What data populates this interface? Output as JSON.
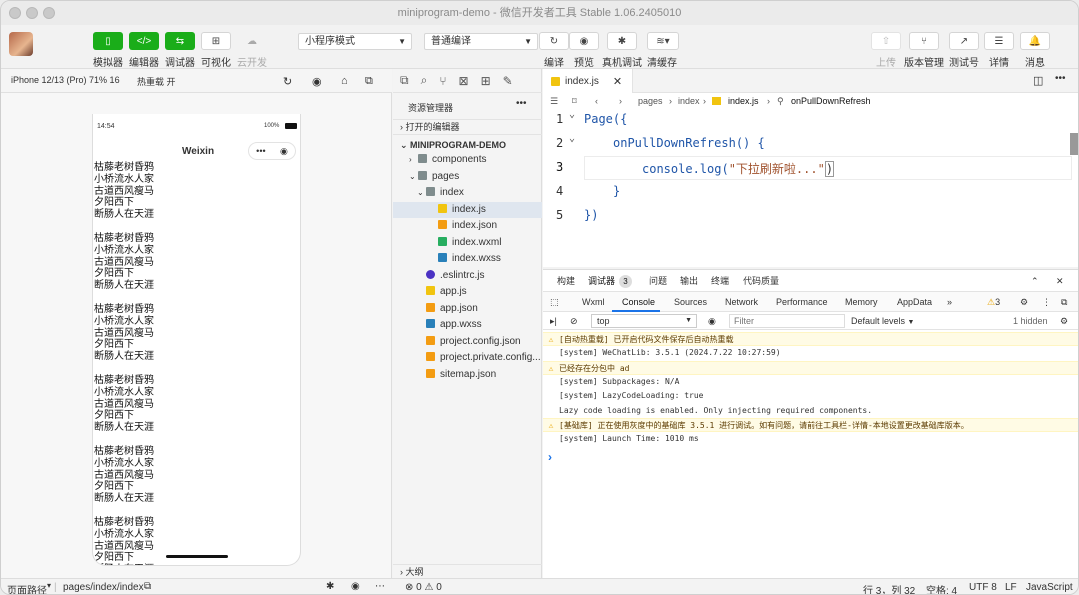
{
  "window": {
    "title": "miniprogram-demo - 微信开发者工具 Stable 1.06.2405010"
  },
  "toolbar": {
    "buttons": [
      {
        "label": "模拟器"
      },
      {
        "label": "编辑器"
      },
      {
        "label": "调试器"
      },
      {
        "label": "可视化"
      },
      {
        "label": "云开发"
      }
    ],
    "mode_select": "小程序模式",
    "compile_select": "普通编译",
    "actions": [
      {
        "label": "编译"
      },
      {
        "label": "预览"
      },
      {
        "label": "真机调试"
      },
      {
        "label": "清缓存"
      }
    ],
    "right_actions": [
      {
        "label": "上传"
      },
      {
        "label": "版本管理"
      },
      {
        "label": "测试号"
      },
      {
        "label": "详情"
      },
      {
        "label": "消息"
      }
    ]
  },
  "simulator": {
    "device": "iPhone 12/13 (Pro) 71% 16",
    "hotreload": "热重载 开",
    "status_time": "14:54",
    "battery": "100%",
    "nav_title": "Weixin",
    "poem_lines": [
      "枯藤老树昏鸦",
      "小桥流水人家",
      "古道西风瘦马",
      "夕阳西下",
      "断肠人在天涯"
    ],
    "repeat": 6
  },
  "explorer": {
    "title": "资源管理器",
    "open_editors": "打开的编辑器",
    "project": "MINIPROGRAM-DEMO",
    "items": [
      {
        "label": "components",
        "type": "folder"
      },
      {
        "label": "pages",
        "type": "folder"
      },
      {
        "label": "index",
        "type": "folder"
      },
      {
        "label": "index.js",
        "type": "js"
      },
      {
        "label": "index.json",
        "type": "json"
      },
      {
        "label": "index.wxml",
        "type": "wxml"
      },
      {
        "label": "index.wxss",
        "type": "wxss"
      },
      {
        "label": ".eslintrc.js",
        "type": "eslint"
      },
      {
        "label": "app.js",
        "type": "js"
      },
      {
        "label": "app.json",
        "type": "json"
      },
      {
        "label": "app.wxss",
        "type": "wxss"
      },
      {
        "label": "project.config.json",
        "type": "json"
      },
      {
        "label": "project.private.config...",
        "type": "json"
      },
      {
        "label": "sitemap.json",
        "type": "json"
      }
    ],
    "outline": "大纲",
    "problems": "⊗ 0 ⚠ 0"
  },
  "editor": {
    "tab": "index.js",
    "breadcrumb": [
      "pages",
      "index",
      "index.js",
      "onPullDownRefresh"
    ],
    "lines": [
      {
        "num": "1",
        "text": "Page({"
      },
      {
        "num": "2",
        "text": "onPullDownRefresh() {"
      },
      {
        "num": "3",
        "text_fn": "console.log(",
        "text_str": "\"下拉刷新啦...\"",
        "text_end": ")"
      },
      {
        "num": "4",
        "text": "}"
      },
      {
        "num": "5",
        "text": "})"
      }
    ]
  },
  "devtools": {
    "panel_tabs": [
      "构建",
      "调试器",
      "问题",
      "输出",
      "终端",
      "代码质量"
    ],
    "debugger_badge": "3",
    "tabs": [
      "Wxml",
      "Console",
      "Sources",
      "Network",
      "Performance",
      "Memory",
      "AppData",
      "»"
    ],
    "warn_count": "3",
    "context": "top",
    "filter_placeholder": "Filter",
    "levels": "Default levels",
    "hidden": "1 hidden",
    "messages": [
      {
        "text": "[自动热重载] 已开启代码文件保存后自动热重载",
        "warn": true
      },
      {
        "text": "[system] WeChatLib: 3.5.1 (2024.7.22 10:27:59)",
        "warn": false
      },
      {
        "text": "已经存在分包中 ad",
        "warn": true
      },
      {
        "text": "[system] Subpackages: N/A",
        "warn": false
      },
      {
        "text": "[system] LazyCodeLoading: true",
        "warn": false
      },
      {
        "text": "Lazy code loading is enabled. Only injecting required components.",
        "warn": false
      },
      {
        "text": "[基础库] 正在使用灰度中的基础库 3.5.1 进行调试。如有问题，请前往工具栏-详情-本地设置更改基础库版本。",
        "warn": true
      },
      {
        "text": "[system] Launch Time: 1010 ms",
        "warn": false
      }
    ],
    "prompt": "›"
  },
  "statusbar": {
    "page_path_label": "页面路径",
    "page_path": "pages/index/index",
    "position": "行 3，列 32",
    "spaces": "空格: 4",
    "encoding": "UTF 8",
    "eol": "LF",
    "language": "JavaScript"
  }
}
